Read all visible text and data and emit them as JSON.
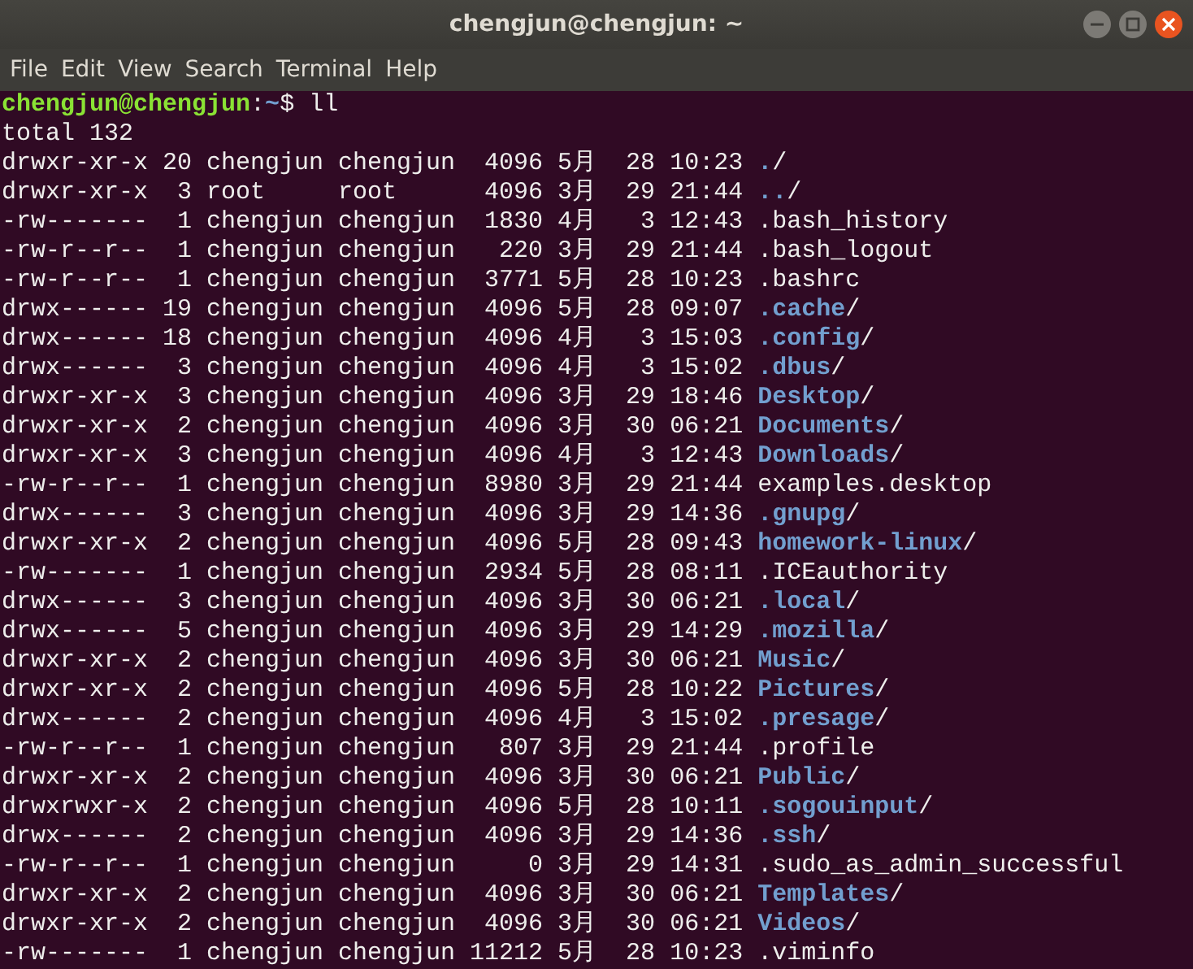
{
  "window": {
    "title": "chengjun@chengjun: ~"
  },
  "menu": [
    "File",
    "Edit",
    "View",
    "Search",
    "Terminal",
    "Help"
  ],
  "prompt": {
    "user": "chengjun@chengjun",
    "separator": ":",
    "path": "~",
    "command": "$ ll"
  },
  "total": "total 132",
  "entries": [
    {
      "info": "drwxr-xr-x 20 chengjun chengjun  4096 5月  28 10:23",
      "name": ".",
      "suffix": "/",
      "kind": "dir"
    },
    {
      "info": "drwxr-xr-x  3 root     root      4096 3月  29 21:44",
      "name": "..",
      "suffix": "/",
      "kind": "dir"
    },
    {
      "info": "-rw-------  1 chengjun chengjun  1830 4月   3 12:43",
      "name": ".bash_history",
      "kind": "file"
    },
    {
      "info": "-rw-r--r--  1 chengjun chengjun   220 3月  29 21:44",
      "name": ".bash_logout",
      "kind": "file"
    },
    {
      "info": "-rw-r--r--  1 chengjun chengjun  3771 5月  28 10:23",
      "name": ".bashrc",
      "kind": "file"
    },
    {
      "info": "drwx------ 19 chengjun chengjun  4096 5月  28 09:07",
      "name": ".cache",
      "suffix": "/",
      "kind": "dir"
    },
    {
      "info": "drwx------ 18 chengjun chengjun  4096 4月   3 15:03",
      "name": ".config",
      "suffix": "/",
      "kind": "dir"
    },
    {
      "info": "drwx------  3 chengjun chengjun  4096 4月   3 15:02",
      "name": ".dbus",
      "suffix": "/",
      "kind": "dir"
    },
    {
      "info": "drwxr-xr-x  3 chengjun chengjun  4096 3月  29 18:46",
      "name": "Desktop",
      "suffix": "/",
      "kind": "dir"
    },
    {
      "info": "drwxr-xr-x  2 chengjun chengjun  4096 3月  30 06:21",
      "name": "Documents",
      "suffix": "/",
      "kind": "dir"
    },
    {
      "info": "drwxr-xr-x  3 chengjun chengjun  4096 4月   3 12:43",
      "name": "Downloads",
      "suffix": "/",
      "kind": "dir"
    },
    {
      "info": "-rw-r--r--  1 chengjun chengjun  8980 3月  29 21:44",
      "name": "examples.desktop",
      "kind": "file"
    },
    {
      "info": "drwx------  3 chengjun chengjun  4096 3月  29 14:36",
      "name": ".gnupg",
      "suffix": "/",
      "kind": "dir"
    },
    {
      "info": "drwxr-xr-x  2 chengjun chengjun  4096 5月  28 09:43",
      "name": "homework-linux",
      "suffix": "/",
      "kind": "dir"
    },
    {
      "info": "-rw-------  1 chengjun chengjun  2934 5月  28 08:11",
      "name": ".ICEauthority",
      "kind": "file"
    },
    {
      "info": "drwx------  3 chengjun chengjun  4096 3月  30 06:21",
      "name": ".local",
      "suffix": "/",
      "kind": "dir"
    },
    {
      "info": "drwx------  5 chengjun chengjun  4096 3月  29 14:29",
      "name": ".mozilla",
      "suffix": "/",
      "kind": "dir"
    },
    {
      "info": "drwxr-xr-x  2 chengjun chengjun  4096 3月  30 06:21",
      "name": "Music",
      "suffix": "/",
      "kind": "dir"
    },
    {
      "info": "drwxr-xr-x  2 chengjun chengjun  4096 5月  28 10:22",
      "name": "Pictures",
      "suffix": "/",
      "kind": "dir"
    },
    {
      "info": "drwx------  2 chengjun chengjun  4096 4月   3 15:02",
      "name": ".presage",
      "suffix": "/",
      "kind": "dir"
    },
    {
      "info": "-rw-r--r--  1 chengjun chengjun   807 3月  29 21:44",
      "name": ".profile",
      "kind": "file"
    },
    {
      "info": "drwxr-xr-x  2 chengjun chengjun  4096 3月  30 06:21",
      "name": "Public",
      "suffix": "/",
      "kind": "dir"
    },
    {
      "info": "drwxrwxr-x  2 chengjun chengjun  4096 5月  28 10:11",
      "name": ".sogouinput",
      "suffix": "/",
      "kind": "dir"
    },
    {
      "info": "drwx------  2 chengjun chengjun  4096 3月  29 14:36",
      "name": ".ssh",
      "suffix": "/",
      "kind": "dir"
    },
    {
      "info": "-rw-r--r--  1 chengjun chengjun     0 3月  29 14:31",
      "name": ".sudo_as_admin_successful",
      "kind": "file"
    },
    {
      "info": "drwxr-xr-x  2 chengjun chengjun  4096 3月  30 06:21",
      "name": "Templates",
      "suffix": "/",
      "kind": "dir"
    },
    {
      "info": "drwxr-xr-x  2 chengjun chengjun  4096 3月  30 06:21",
      "name": "Videos",
      "suffix": "/",
      "kind": "dir"
    },
    {
      "info": "-rw-------  1 chengjun chengjun 11212 5月  28 10:23",
      "name": ".viminfo",
      "kind": "file"
    }
  ]
}
